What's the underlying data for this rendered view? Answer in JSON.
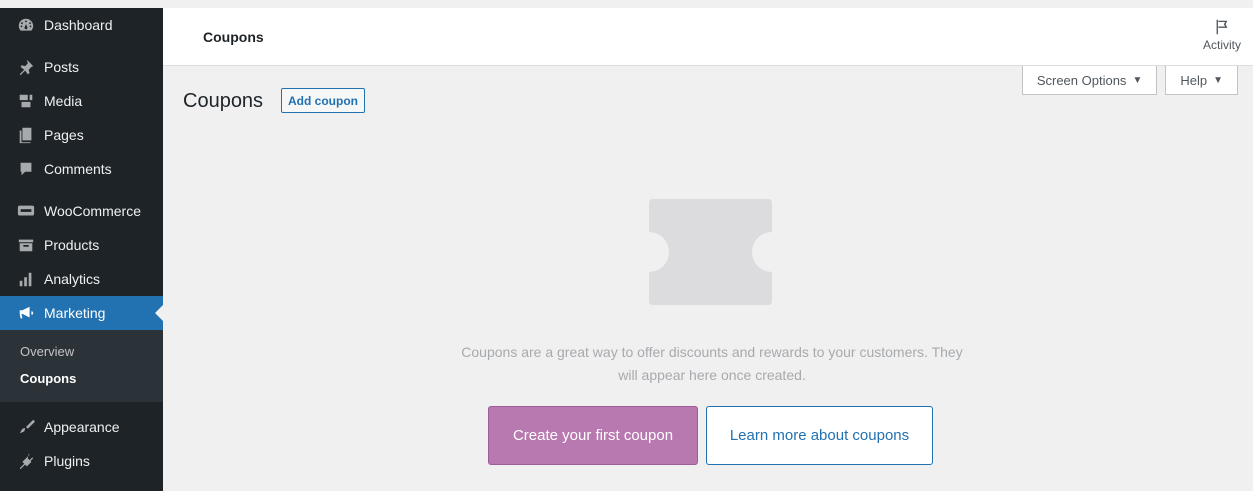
{
  "sidebar": {
    "items": [
      {
        "label": "Dashboard",
        "icon": "dashboard-icon"
      },
      {
        "label": "Posts",
        "icon": "pushpin-icon"
      },
      {
        "label": "Media",
        "icon": "media-icon"
      },
      {
        "label": "Pages",
        "icon": "pages-icon"
      },
      {
        "label": "Comments",
        "icon": "comments-icon"
      },
      {
        "label": "WooCommerce",
        "icon": "woocommerce-icon"
      },
      {
        "label": "Products",
        "icon": "products-icon"
      },
      {
        "label": "Analytics",
        "icon": "analytics-icon"
      },
      {
        "label": "Marketing",
        "icon": "megaphone-icon"
      },
      {
        "label": "Appearance",
        "icon": "paintbrush-icon"
      },
      {
        "label": "Plugins",
        "icon": "plugins-icon"
      }
    ],
    "submenu": [
      {
        "label": "Overview"
      },
      {
        "label": "Coupons"
      }
    ]
  },
  "header": {
    "breadcrumb": "Coupons",
    "activity_label": "Activity"
  },
  "screen_options": {
    "screen_options_label": "Screen Options",
    "help_label": "Help"
  },
  "main": {
    "title": "Coupons",
    "add_button": "Add coupon",
    "empty_message": "Coupons are a great way to offer discounts and rewards to your customers. They will appear here once created.",
    "primary_cta": "Create your first coupon",
    "secondary_cta": "Learn more about coupons"
  },
  "colors": {
    "sidebar_bg": "#1d2327",
    "active_bg": "#2271b1",
    "primary_cta_bg": "#b878b0",
    "page_bg": "#f0f0f1"
  }
}
